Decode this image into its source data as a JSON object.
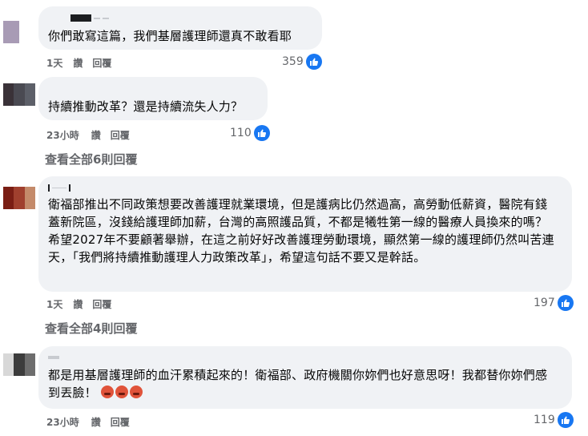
{
  "comments": [
    {
      "text": "你們敢寫這篇，我們基層護理師還真不敢看耶",
      "time": "1天",
      "like_label": "讚",
      "reply_label": "回覆",
      "reactions": "359"
    },
    {
      "text": "持續推動改革？還是持續流失人力？",
      "time": "23小時",
      "like_label": "讚",
      "reply_label": "回覆",
      "reactions": "110"
    },
    {
      "text": "衛福部推出不同政策想要改善護理就業環境，但是護病比仍然過高，高勞動低薪資，醫院有錢蓋新院區，沒錢給護理師加薪，台灣的高照護品質，不都是犧牲第一線的醫療人員換來的嗎？希望2027年不要顧著舉辦，在這之前好好改善護理勞動環境，顯然第一線的護理師仍然叫苦連天，「我們將持續推動護理人力政策改革」，希望這句話不要又是幹話。",
      "time": "1天",
      "like_label": "讚",
      "reply_label": "回覆",
      "reactions": "197"
    },
    {
      "text": "都是用基層護理師的血汗累積起來的！衛福部、政府機關你妳們也好意思呀！我都替你妳們感到丟臉！",
      "time": "23小時",
      "like_label": "讚",
      "reply_label": "回覆",
      "reactions": "119"
    }
  ],
  "view_more_1": "查看全部6則回覆",
  "view_more_2": "查看全部4則回覆",
  "colors": {
    "bubble": "#f0f2f5",
    "like_blue": "#1877f2",
    "meta_gray": "#65676b"
  }
}
